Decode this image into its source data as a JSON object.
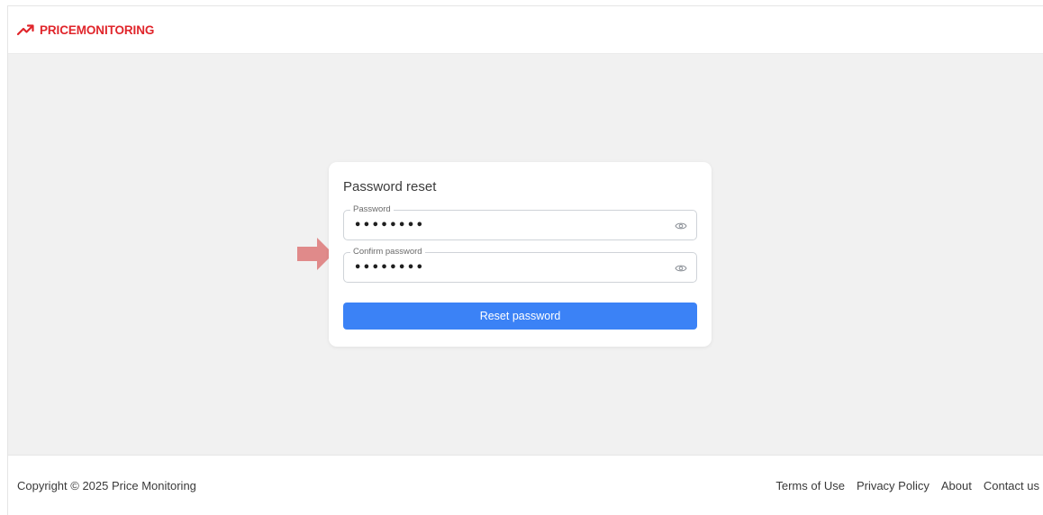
{
  "header": {
    "brand": "PRICEMONITORING",
    "logo_icon": "trending-up-icon",
    "brand_color": "#e0252b"
  },
  "card": {
    "title": "Password reset",
    "fields": [
      {
        "label": "Password",
        "value": "••••••••",
        "icon": "eye-icon"
      },
      {
        "label": "Confirm password",
        "value": "••••••••",
        "icon": "eye-icon"
      }
    ],
    "submit_label": "Reset password",
    "submit_color": "#3b82f6"
  },
  "annotation": {
    "icon": "arrow-right-icon",
    "color": "#e08a8a"
  },
  "footer": {
    "copyright": "Copyright © 2025 Price Monitoring",
    "links": [
      "Terms of Use",
      "Privacy Policy",
      "About",
      "Contact us"
    ]
  }
}
